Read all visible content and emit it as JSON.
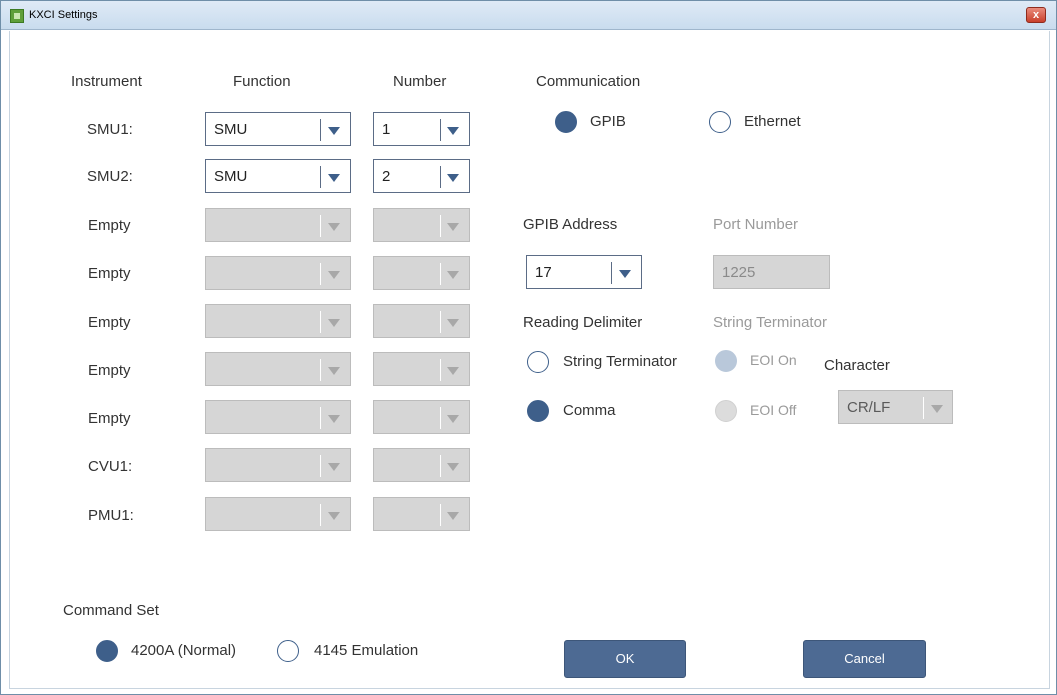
{
  "window": {
    "title": "KXCI Settings",
    "close_label": "x"
  },
  "columns": {
    "instrument": "Instrument",
    "function": "Function",
    "number": "Number"
  },
  "rows": [
    {
      "instrument": "SMU1:",
      "function": "SMU",
      "number": "1",
      "enabled": true
    },
    {
      "instrument": "SMU2:",
      "function": "SMU",
      "number": "2",
      "enabled": true
    },
    {
      "instrument": "Empty",
      "function": "",
      "number": "",
      "enabled": false
    },
    {
      "instrument": "Empty",
      "function": "",
      "number": "",
      "enabled": false
    },
    {
      "instrument": "Empty",
      "function": "",
      "number": "",
      "enabled": false
    },
    {
      "instrument": "Empty",
      "function": "",
      "number": "",
      "enabled": false
    },
    {
      "instrument": "Empty",
      "function": "",
      "number": "",
      "enabled": false
    },
    {
      "instrument": "CVU1:",
      "function": "",
      "number": "",
      "enabled": false
    },
    {
      "instrument": "PMU1:",
      "function": "",
      "number": "",
      "enabled": false
    }
  ],
  "communication": {
    "label": "Communication",
    "options": [
      {
        "label": "GPIB",
        "selected": true
      },
      {
        "label": "Ethernet",
        "selected": false
      }
    ]
  },
  "gpib": {
    "label": "GPIB Address",
    "value": "17"
  },
  "port": {
    "label": "Port Number",
    "value": "1225"
  },
  "reading_delimiter": {
    "label": "Reading Delimiter",
    "options": [
      {
        "label": "String Terminator",
        "selected": false
      },
      {
        "label": "Comma",
        "selected": true
      }
    ]
  },
  "string_terminator": {
    "label": "String Terminator",
    "options": [
      {
        "label": "EOI On",
        "selected": true
      },
      {
        "label": "EOI Off",
        "selected": false
      }
    ],
    "character_label": "Character",
    "character_value": "CR/LF"
  },
  "command_set": {
    "label": "Command Set",
    "options": [
      {
        "label": "4200A (Normal)",
        "selected": true
      },
      {
        "label": "4145 Emulation",
        "selected": false
      }
    ]
  },
  "buttons": {
    "ok": "OK",
    "cancel": "Cancel"
  },
  "colors": {
    "accent": "#3e5f8a",
    "button": "#4d6a93",
    "disabled": "#d6d6d6"
  }
}
